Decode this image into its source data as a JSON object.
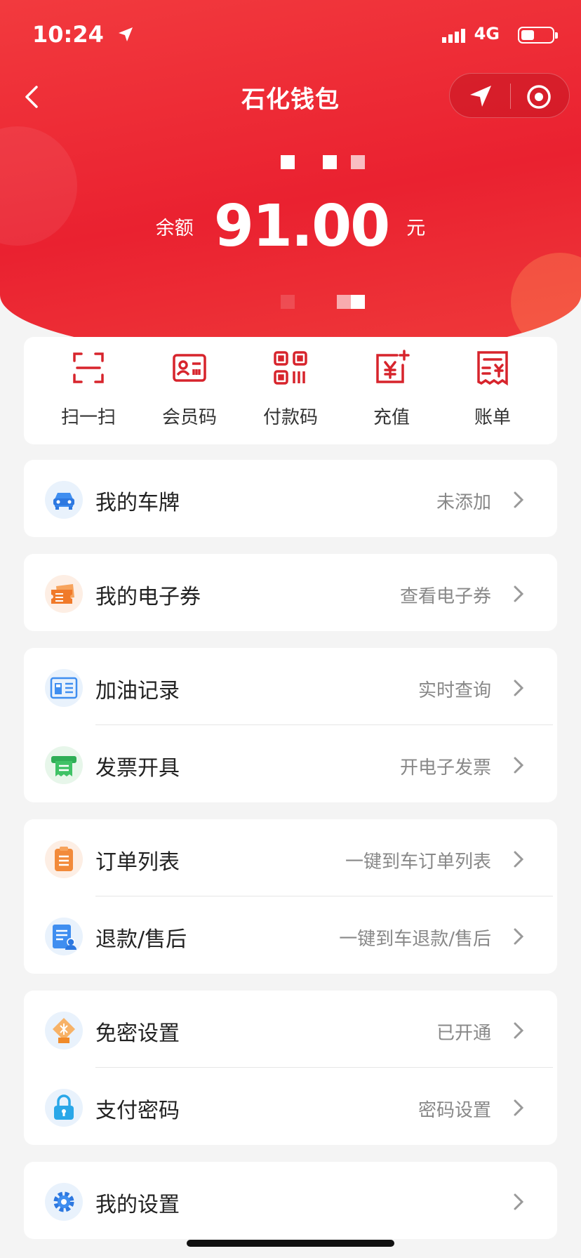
{
  "status": {
    "time": "10:24",
    "network": "4G"
  },
  "nav": {
    "title": "石化钱包"
  },
  "balance": {
    "label": "余额",
    "amount": "91.00",
    "unit": "元"
  },
  "quick_actions": [
    {
      "label": "扫一扫",
      "icon": "scan-icon"
    },
    {
      "label": "会员码",
      "icon": "member-card-icon"
    },
    {
      "label": "付款码",
      "icon": "qr-code-icon"
    },
    {
      "label": "充值",
      "icon": "recharge-icon"
    },
    {
      "label": "账单",
      "icon": "bill-icon"
    }
  ],
  "groups": [
    [
      {
        "label": "我的车牌",
        "value": "未添加",
        "icon": "car-icon"
      }
    ],
    [
      {
        "label": "我的电子券",
        "value": "查看电子券",
        "icon": "coupon-icon"
      }
    ],
    [
      {
        "label": "加油记录",
        "value": "实时查询",
        "icon": "fuel-record-icon"
      },
      {
        "label": "发票开具",
        "value": "开电子发票",
        "icon": "invoice-icon"
      }
    ],
    [
      {
        "label": "订单列表",
        "value": "一键到车订单列表",
        "icon": "order-list-icon"
      },
      {
        "label": "退款/售后",
        "value": "一键到车退款/售后",
        "icon": "refund-icon"
      }
    ],
    [
      {
        "label": "免密设置",
        "value": "已开通",
        "icon": "password-free-icon"
      },
      {
        "label": "支付密码",
        "value": "密码设置",
        "icon": "lock-icon"
      }
    ],
    [
      {
        "label": "我的设置",
        "value": "",
        "icon": "settings-gear-icon"
      }
    ]
  ],
  "colors": {
    "brand": "#ea2130",
    "icon_red": "#d7242c"
  }
}
